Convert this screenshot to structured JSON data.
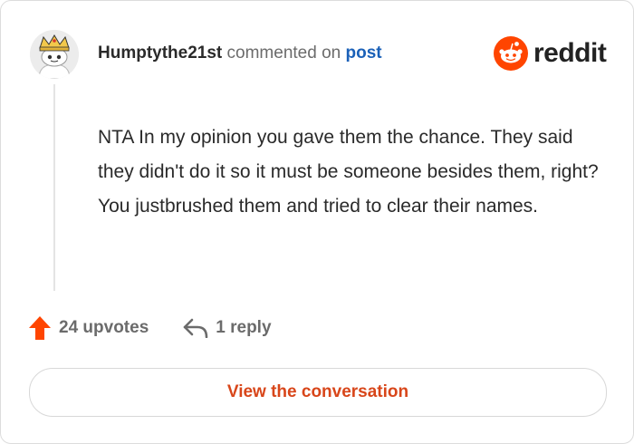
{
  "comment": {
    "username": "Humptythe21st",
    "action_text": "commented on",
    "target_text": "post",
    "body": "NTA In my opinion you gave them the chance. They said they didn't do it so it must be someone besides them, right? You justbrushed them and tried to clear their names."
  },
  "brand": {
    "logo_text": "reddit",
    "color": "#FF4500",
    "icon": "reddit-snoo-icon"
  },
  "actions": {
    "upvotes_label": "24 upvotes",
    "upvote_icon": "upvote-arrow-icon",
    "upvote_color": "#FF4500",
    "reply_label": "1 reply",
    "reply_icon": "reply-arrow-icon"
  },
  "footer": {
    "conversation_label": "View the conversation",
    "link_color": "#D8461A"
  }
}
